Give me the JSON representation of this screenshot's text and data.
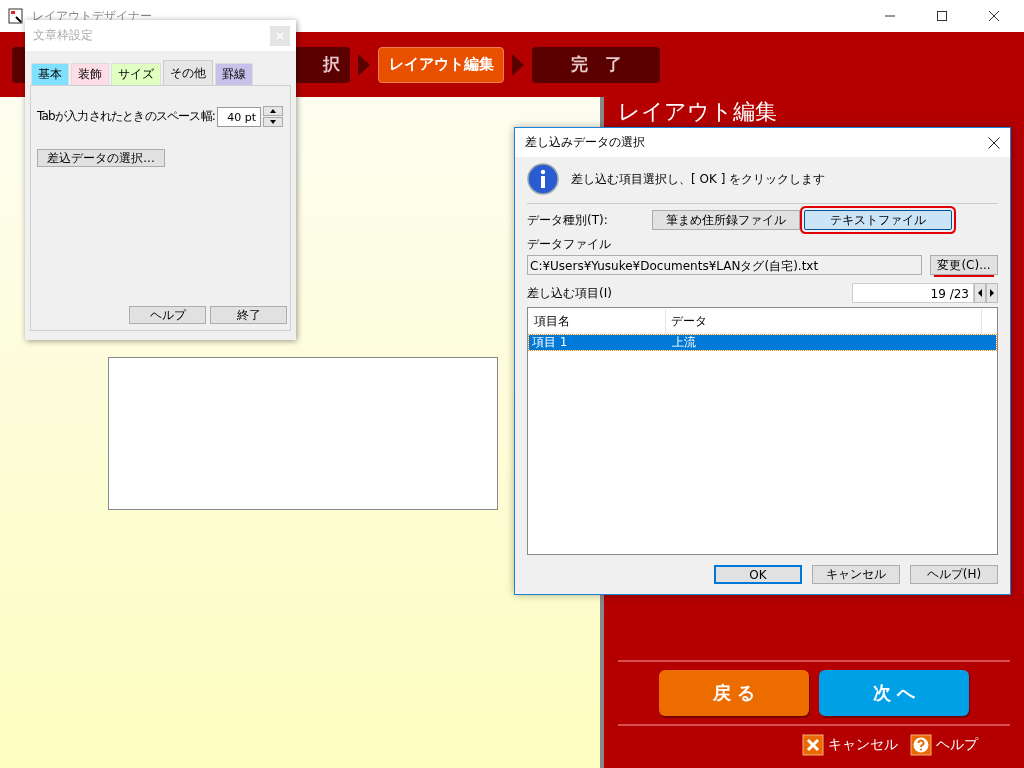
{
  "window": {
    "title": "レイアウトデザイナー"
  },
  "steps": [
    {
      "selected": false
    },
    {
      "label": "択",
      "selected": false
    },
    {
      "label": "レイアウト編集",
      "selected": true
    },
    {
      "label": "完　了",
      "selected": false
    }
  ],
  "panel": {
    "heading": "レイアウト編集",
    "nav_buttons": [
      {
        "label": "戻 る",
        "kind": "back"
      },
      {
        "label": "次 へ",
        "kind": "next"
      }
    ],
    "links": [
      {
        "label": "キャンセル",
        "kind": "cancel"
      },
      {
        "label": "ヘルプ",
        "kind": "help"
      }
    ]
  },
  "text_frame_dialog": {
    "title": "文章枠設定",
    "tabs": [
      {
        "label": "基本",
        "color": "#80e0ff",
        "selected": false
      },
      {
        "label": "装飾",
        "color": "#ffdde6",
        "selected": false
      },
      {
        "label": "サイズ",
        "color": "#e0ffc0",
        "selected": false
      },
      {
        "label": "その他",
        "color": "#e6e6e6",
        "selected": true
      },
      {
        "label": "罫線",
        "color": "#c8c0e8",
        "selected": false
      }
    ],
    "tab_width_label": "Tabが入力されたときのスペース幅:",
    "tab_width_value": "40 pt",
    "merge_button": "差込データの選択...",
    "buttons": [
      "ヘルプ",
      "終了"
    ]
  },
  "merge_dialog": {
    "title": "差し込みデータの選択",
    "message": "差し込む項目選択し、[ OK ] をクリックします",
    "data_type_label": "データ種別(T):",
    "data_type_options": [
      {
        "label": "筆まめ住所録ファイル",
        "selected": false
      },
      {
        "label": "テキストファイル",
        "selected": true
      }
    ],
    "data_file_label": "データファイル",
    "data_file_path": "C:¥Users¥Yusuke¥Documents¥LANタグ(自宅).txt",
    "change_button": {
      "label": "変更(C)...",
      "highlighted": true
    },
    "items_label": "差し込む項目(I)",
    "item_counter": "19 /23",
    "columns": [
      "項目名",
      "データ"
    ],
    "rows": [
      {
        "cells": [
          "項目 1",
          "上流"
        ],
        "selected": true
      }
    ],
    "buttons": [
      {
        "label": "OK",
        "default": true
      },
      {
        "label": "キャンセル",
        "default": false
      },
      {
        "label": "ヘルプ(H)",
        "default": false
      }
    ]
  }
}
